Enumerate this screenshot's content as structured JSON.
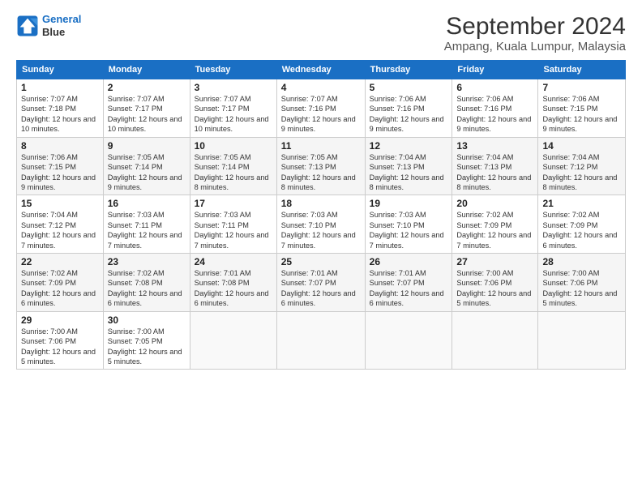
{
  "logo": {
    "line1": "General",
    "line2": "Blue"
  },
  "title": "September 2024",
  "subtitle": "Ampang, Kuala Lumpur, Malaysia",
  "days_of_week": [
    "Sunday",
    "Monday",
    "Tuesday",
    "Wednesday",
    "Thursday",
    "Friday",
    "Saturday"
  ],
  "weeks": [
    [
      {
        "day": "1",
        "sunrise": "7:07 AM",
        "sunset": "7:18 PM",
        "daylight": "12 hours and 10 minutes."
      },
      {
        "day": "2",
        "sunrise": "7:07 AM",
        "sunset": "7:17 PM",
        "daylight": "12 hours and 10 minutes."
      },
      {
        "day": "3",
        "sunrise": "7:07 AM",
        "sunset": "7:17 PM",
        "daylight": "12 hours and 10 minutes."
      },
      {
        "day": "4",
        "sunrise": "7:07 AM",
        "sunset": "7:16 PM",
        "daylight": "12 hours and 9 minutes."
      },
      {
        "day": "5",
        "sunrise": "7:06 AM",
        "sunset": "7:16 PM",
        "daylight": "12 hours and 9 minutes."
      },
      {
        "day": "6",
        "sunrise": "7:06 AM",
        "sunset": "7:16 PM",
        "daylight": "12 hours and 9 minutes."
      },
      {
        "day": "7",
        "sunrise": "7:06 AM",
        "sunset": "7:15 PM",
        "daylight": "12 hours and 9 minutes."
      }
    ],
    [
      {
        "day": "8",
        "sunrise": "7:06 AM",
        "sunset": "7:15 PM",
        "daylight": "12 hours and 9 minutes."
      },
      {
        "day": "9",
        "sunrise": "7:05 AM",
        "sunset": "7:14 PM",
        "daylight": "12 hours and 9 minutes."
      },
      {
        "day": "10",
        "sunrise": "7:05 AM",
        "sunset": "7:14 PM",
        "daylight": "12 hours and 8 minutes."
      },
      {
        "day": "11",
        "sunrise": "7:05 AM",
        "sunset": "7:13 PM",
        "daylight": "12 hours and 8 minutes."
      },
      {
        "day": "12",
        "sunrise": "7:04 AM",
        "sunset": "7:13 PM",
        "daylight": "12 hours and 8 minutes."
      },
      {
        "day": "13",
        "sunrise": "7:04 AM",
        "sunset": "7:13 PM",
        "daylight": "12 hours and 8 minutes."
      },
      {
        "day": "14",
        "sunrise": "7:04 AM",
        "sunset": "7:12 PM",
        "daylight": "12 hours and 8 minutes."
      }
    ],
    [
      {
        "day": "15",
        "sunrise": "7:04 AM",
        "sunset": "7:12 PM",
        "daylight": "12 hours and 7 minutes."
      },
      {
        "day": "16",
        "sunrise": "7:03 AM",
        "sunset": "7:11 PM",
        "daylight": "12 hours and 7 minutes."
      },
      {
        "day": "17",
        "sunrise": "7:03 AM",
        "sunset": "7:11 PM",
        "daylight": "12 hours and 7 minutes."
      },
      {
        "day": "18",
        "sunrise": "7:03 AM",
        "sunset": "7:10 PM",
        "daylight": "12 hours and 7 minutes."
      },
      {
        "day": "19",
        "sunrise": "7:03 AM",
        "sunset": "7:10 PM",
        "daylight": "12 hours and 7 minutes."
      },
      {
        "day": "20",
        "sunrise": "7:02 AM",
        "sunset": "7:09 PM",
        "daylight": "12 hours and 7 minutes."
      },
      {
        "day": "21",
        "sunrise": "7:02 AM",
        "sunset": "7:09 PM",
        "daylight": "12 hours and 6 minutes."
      }
    ],
    [
      {
        "day": "22",
        "sunrise": "7:02 AM",
        "sunset": "7:09 PM",
        "daylight": "12 hours and 6 minutes."
      },
      {
        "day": "23",
        "sunrise": "7:02 AM",
        "sunset": "7:08 PM",
        "daylight": "12 hours and 6 minutes."
      },
      {
        "day": "24",
        "sunrise": "7:01 AM",
        "sunset": "7:08 PM",
        "daylight": "12 hours and 6 minutes."
      },
      {
        "day": "25",
        "sunrise": "7:01 AM",
        "sunset": "7:07 PM",
        "daylight": "12 hours and 6 minutes."
      },
      {
        "day": "26",
        "sunrise": "7:01 AM",
        "sunset": "7:07 PM",
        "daylight": "12 hours and 6 minutes."
      },
      {
        "day": "27",
        "sunrise": "7:00 AM",
        "sunset": "7:06 PM",
        "daylight": "12 hours and 5 minutes."
      },
      {
        "day": "28",
        "sunrise": "7:00 AM",
        "sunset": "7:06 PM",
        "daylight": "12 hours and 5 minutes."
      }
    ],
    [
      {
        "day": "29",
        "sunrise": "7:00 AM",
        "sunset": "7:06 PM",
        "daylight": "12 hours and 5 minutes."
      },
      {
        "day": "30",
        "sunrise": "7:00 AM",
        "sunset": "7:05 PM",
        "daylight": "12 hours and 5 minutes."
      },
      null,
      null,
      null,
      null,
      null
    ]
  ]
}
